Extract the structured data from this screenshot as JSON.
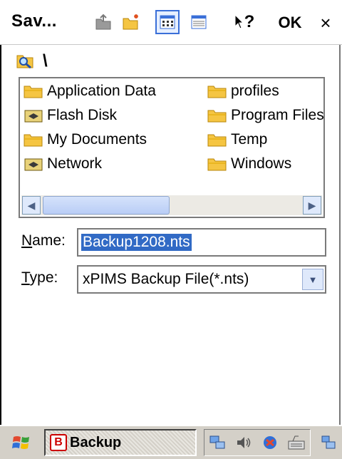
{
  "titlebar": {
    "title": "Sav...",
    "ok_label": "OK",
    "close_label": "×",
    "help_label": "?"
  },
  "path": {
    "text": "\\"
  },
  "files": [
    {
      "name": "Application Data",
      "icon": "folder-icon"
    },
    {
      "name": "Flash Disk",
      "icon": "storage-card-icon"
    },
    {
      "name": "My Documents",
      "icon": "folder-icon"
    },
    {
      "name": "Network",
      "icon": "storage-card-icon"
    },
    {
      "name": "profiles",
      "icon": "folder-icon"
    },
    {
      "name": "Program Files",
      "icon": "folder-icon"
    },
    {
      "name": "Temp",
      "icon": "folder-icon"
    },
    {
      "name": "Windows",
      "icon": "folder-icon"
    }
  ],
  "name_field": {
    "label_mnemonic": "N",
    "label_rest": "ame:",
    "value": "Backup1208.nts"
  },
  "type_field": {
    "label_mnemonic": "T",
    "label_rest": "ype:",
    "value": "xPIMS Backup File(*.nts)"
  },
  "taskbar": {
    "task_label": "Backup",
    "task_badge": "B"
  },
  "colors": {
    "selection": "#316ac5",
    "folder": "#f5c542",
    "accent": "#3a6fd8"
  }
}
